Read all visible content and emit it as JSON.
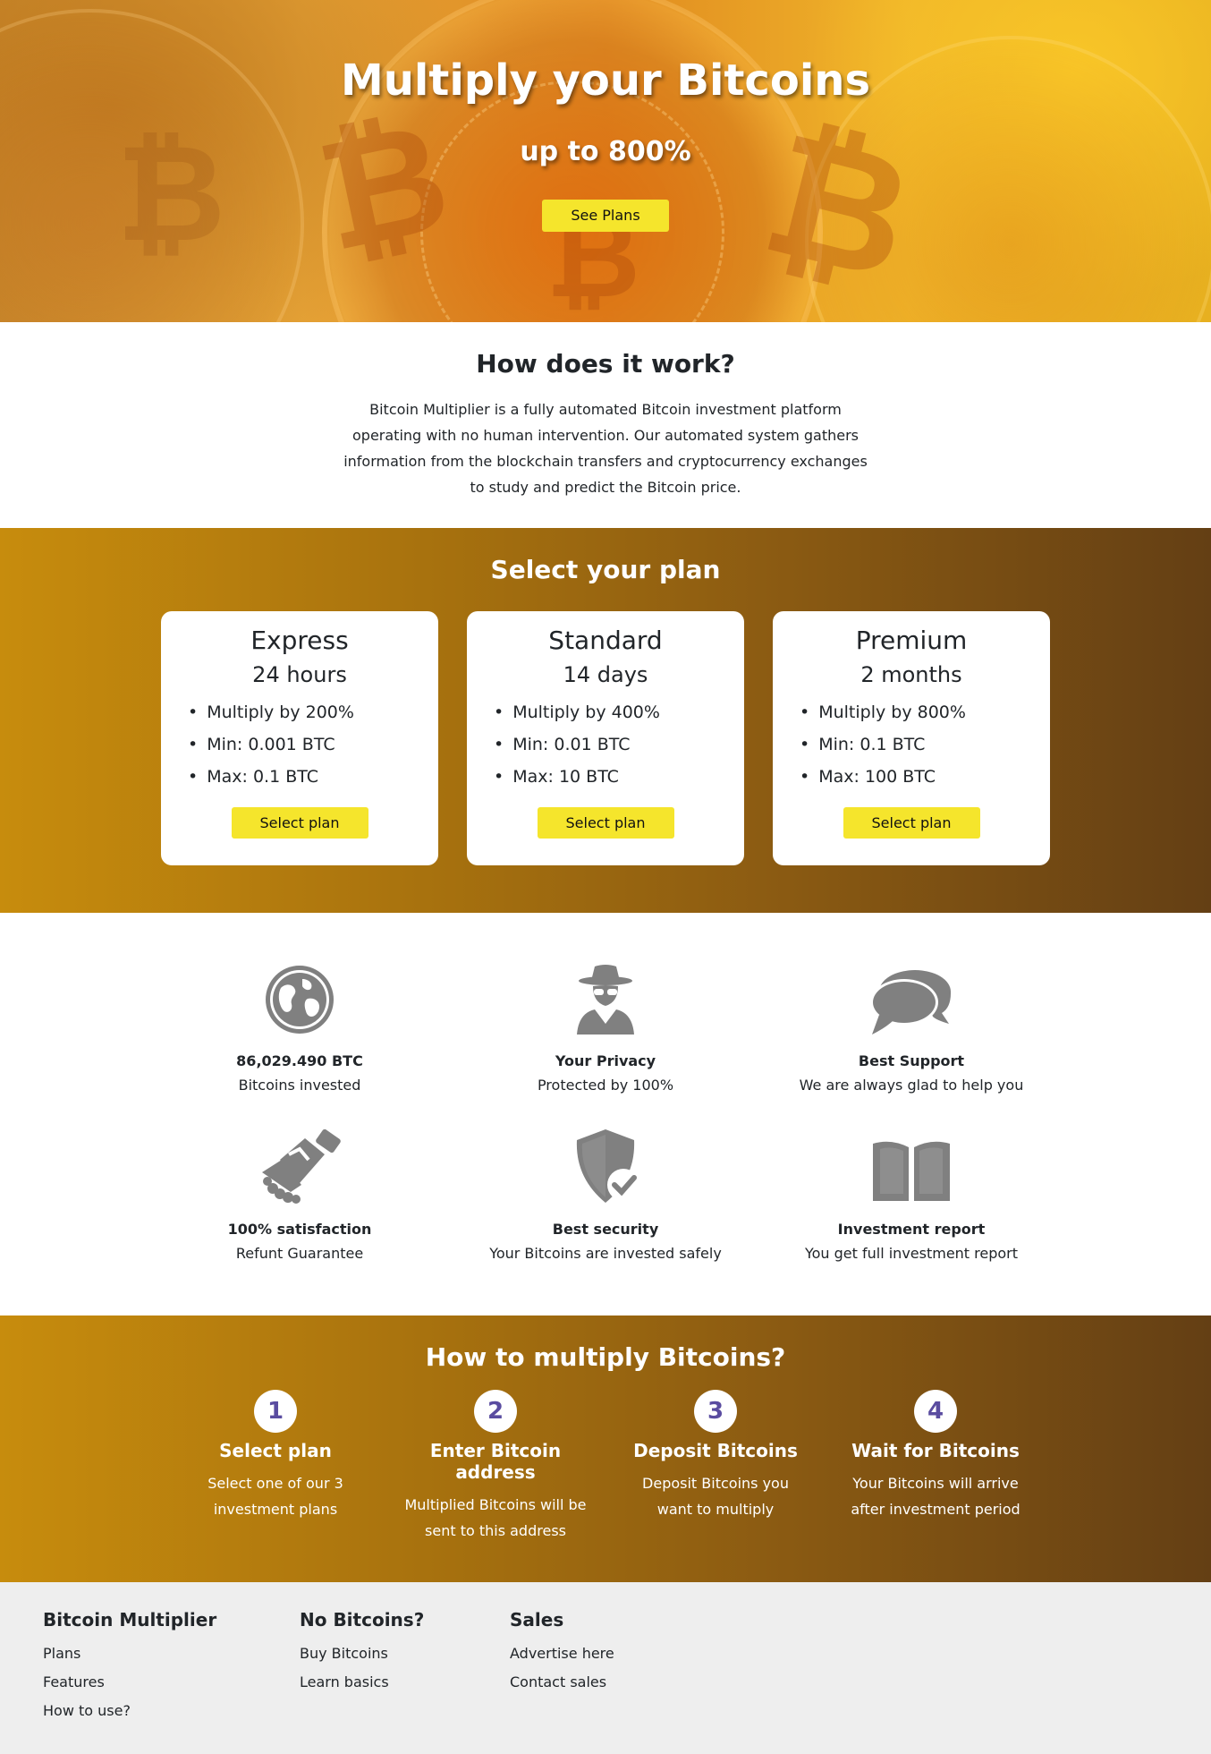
{
  "hero": {
    "title": "Multiply your Bitcoins",
    "subtitle": "up to 800%",
    "cta_label": "See Plans"
  },
  "how": {
    "title": "How does it work?",
    "text": "Bitcoin Multiplier is a fully automated Bitcoin investment platform operating with no human intervention. Our automated system gathers information from the blockchain transfers and cryptocurrency exchanges to study and predict the Bitcoin price."
  },
  "plans": {
    "title": "Select your plan",
    "items": [
      {
        "name": "Express",
        "duration": "24 hours",
        "features": [
          "Multiply by 200%",
          "Min: 0.001 BTC",
          "Max: 0.1 BTC"
        ],
        "button": "Select plan"
      },
      {
        "name": "Standard",
        "duration": "14 days",
        "features": [
          "Multiply by 400%",
          "Min: 0.01 BTC",
          "Max: 10 BTC"
        ],
        "button": "Select plan"
      },
      {
        "name": "Premium",
        "duration": "2 months",
        "features": [
          "Multiply by 800%",
          "Min: 0.1 BTC",
          "Max: 100 BTC"
        ],
        "button": "Select plan"
      }
    ]
  },
  "features": [
    {
      "icon": "globe-icon",
      "title": "86,029.490 BTC",
      "subtitle": "Bitcoins invested"
    },
    {
      "icon": "spy-icon",
      "title": "Your Privacy",
      "subtitle": "Protected by 100%"
    },
    {
      "icon": "chat-bubbles-icon",
      "title": "Best Support",
      "subtitle": "We are always glad to help you"
    },
    {
      "icon": "handshake-icon",
      "title": "100% satisfaction",
      "subtitle": "Refunt Guarantee"
    },
    {
      "icon": "shield-check-icon",
      "title": "Best security",
      "subtitle": "Your Bitcoins are invested safely"
    },
    {
      "icon": "book-open-icon",
      "title": "Investment report",
      "subtitle": "You get full investment report"
    }
  ],
  "steps": {
    "title": "How to multiply Bitcoins?",
    "items": [
      {
        "number": "1",
        "title": "Select plan",
        "text": "Select one of our 3 investment plans"
      },
      {
        "number": "2",
        "title": "Enter Bitcoin address",
        "text": "Multiplied Bitcoins will be sent to this address"
      },
      {
        "number": "3",
        "title": "Deposit Bitcoins",
        "text": "Deposit Bitcoins you want to multiply"
      },
      {
        "number": "4",
        "title": "Wait for Bitcoins",
        "text": "Your Bitcoins will arrive after investment period"
      }
    ]
  },
  "footer": {
    "columns": [
      {
        "title": "Bitcoin Multiplier",
        "links": [
          "Plans",
          "Features",
          "How to use?"
        ]
      },
      {
        "title": "No Bitcoins?",
        "links": [
          "Buy Bitcoins",
          "Learn basics"
        ]
      },
      {
        "title": "Sales",
        "links": [
          "Advertise here",
          "Contact sales"
        ]
      }
    ]
  },
  "colors": {
    "accent_button": "#f5e52c",
    "brown_start": "#c78c0d",
    "brown_end": "#643f14",
    "icon_gray": "#808080",
    "step_number": "#5a4ca0"
  }
}
